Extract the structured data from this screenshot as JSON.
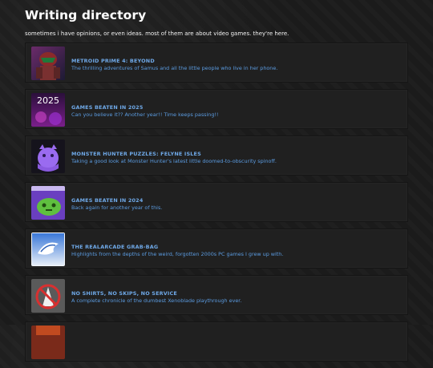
{
  "header": {
    "title": "Writing directory",
    "subtitle": "sometimes i have opinions, or even ideas. most of them are about video games. they're here."
  },
  "entries": [
    {
      "title": "METROID PRIME 4: BEYOND",
      "description": "The thrilling adventures of Samus and all the little people who live in her phone.",
      "icon": "metroid-prime-thumbnail"
    },
    {
      "title": "GAMES BEATEN IN 2025",
      "description": "Can you believe it?? Another year!! Time keeps passing!!",
      "icon": "games-2025-thumbnail",
      "thumb_text": "2025"
    },
    {
      "title": "MONSTER HUNTER PUZZLES: FELYNE ISLES",
      "description": "Taking a good look at Monster Hunter's latest little doomed-to-obscurity spinoff.",
      "icon": "felyne-isles-thumbnail"
    },
    {
      "title": "GAMES BEATEN IN 2024",
      "description": "Back again for another year of this.",
      "icon": "games-2024-thumbnail"
    },
    {
      "title": "THE REALARCADE GRAB-BAG",
      "description": "Highlights from the depths of the weird, forgotten 2000s PC games I grew up with.",
      "icon": "realarcade-thumbnail"
    },
    {
      "title": "NO SHIRTS, NO SKIPS, NO SERVICE",
      "description": "A complete chronicle of the dumbest Xenoblade playthrough ever.",
      "icon": "no-shirts-thumbnail"
    }
  ]
}
